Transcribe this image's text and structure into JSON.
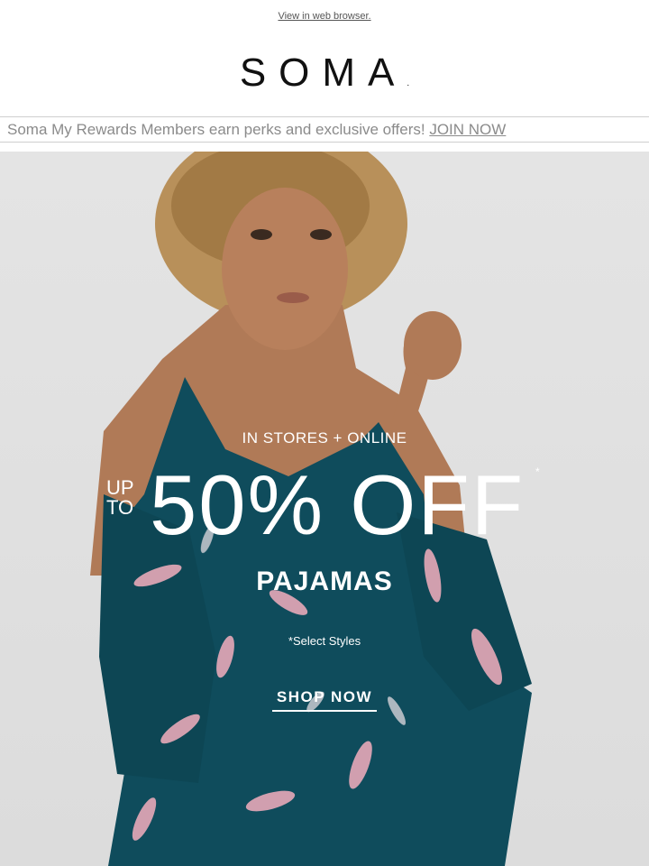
{
  "header": {
    "view_in_browser": "View in web browser.",
    "logo_text": "SOMA",
    "logo_mark": "."
  },
  "rewards_bar": {
    "text": "Soma My Rewards Members earn perks and exclusive offers! ",
    "link": "JOIN NOW"
  },
  "hero": {
    "channel": "IN STORES + ONLINE",
    "up_to_line1": "UP",
    "up_to_line2": "TO",
    "discount": "50% OFF",
    "asterisk": "*",
    "category": "PAJAMAS",
    "disclaimer": "*Select Styles",
    "cta": "SHOP NOW"
  },
  "colors": {
    "background": "#dcdcdc",
    "pajama_teal": "#0f4c5c",
    "print_pink": "#e7a9b8"
  }
}
